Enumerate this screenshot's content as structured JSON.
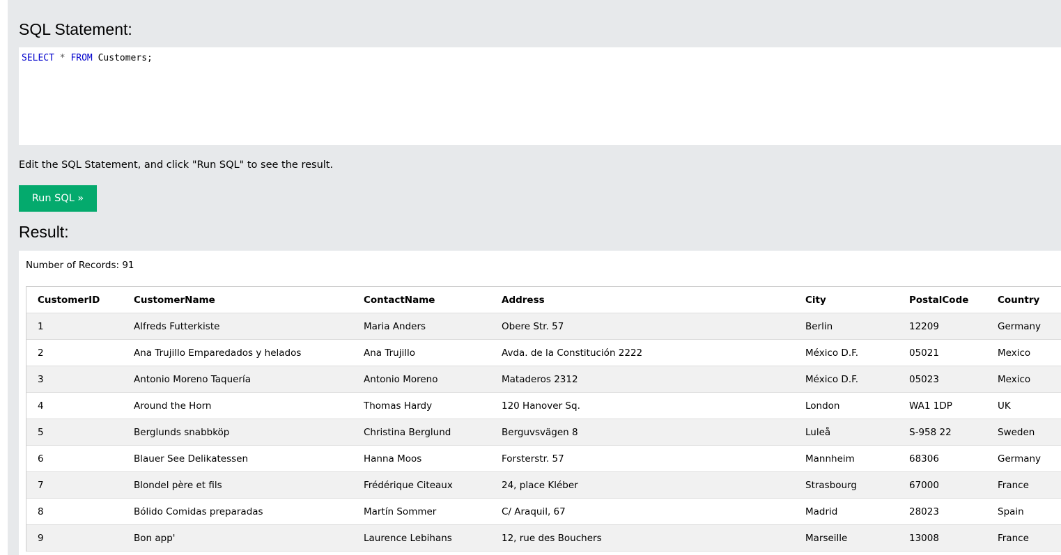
{
  "sql_section": {
    "heading": "SQL Statement:",
    "code": {
      "kw1": "SELECT",
      "op": "*",
      "kw2": "FROM",
      "table": "Customers;"
    },
    "hint": "Edit the SQL Statement, and click \"Run SQL\" to see the result.",
    "run_label": "Run SQL »"
  },
  "result_section": {
    "heading": "Result:",
    "records_text": "Number of Records: 91",
    "columns": [
      "CustomerID",
      "CustomerName",
      "ContactName",
      "Address",
      "City",
      "PostalCode",
      "Country"
    ],
    "rows": [
      [
        "1",
        "Alfreds Futterkiste",
        "Maria Anders",
        "Obere Str. 57",
        "Berlin",
        "12209",
        "Germany"
      ],
      [
        "2",
        "Ana Trujillo Emparedados y helados",
        "Ana Trujillo",
        "Avda. de la Constitución 2222",
        "México D.F.",
        "05021",
        "Mexico"
      ],
      [
        "3",
        "Antonio Moreno Taquería",
        "Antonio Moreno",
        "Mataderos 2312",
        "México D.F.",
        "05023",
        "Mexico"
      ],
      [
        "4",
        "Around the Horn",
        "Thomas Hardy",
        "120 Hanover Sq.",
        "London",
        "WA1 1DP",
        "UK"
      ],
      [
        "5",
        "Berglunds snabbköp",
        "Christina Berglund",
        "Berguvsvägen 8",
        "Luleå",
        "S-958 22",
        "Sweden"
      ],
      [
        "6",
        "Blauer See Delikatessen",
        "Hanna Moos",
        "Forsterstr. 57",
        "Mannheim",
        "68306",
        "Germany"
      ],
      [
        "7",
        "Blondel père et fils",
        "Frédérique Citeaux",
        "24, place Kléber",
        "Strasbourg",
        "67000",
        "France"
      ],
      [
        "8",
        "Bólido Comidas preparadas",
        "Martín Sommer",
        "C/ Araquil, 67",
        "Madrid",
        "28023",
        "Spain"
      ],
      [
        "9",
        "Bon app'",
        "Laurence Lebihans",
        "12, rue des Bouchers",
        "Marseille",
        "13008",
        "France"
      ]
    ]
  },
  "colors": {
    "panel_bg": "#e7e9eb",
    "button_bg": "#04aa6d",
    "keyword": "#0000cc",
    "row_stripe": "#f1f1f1"
  }
}
